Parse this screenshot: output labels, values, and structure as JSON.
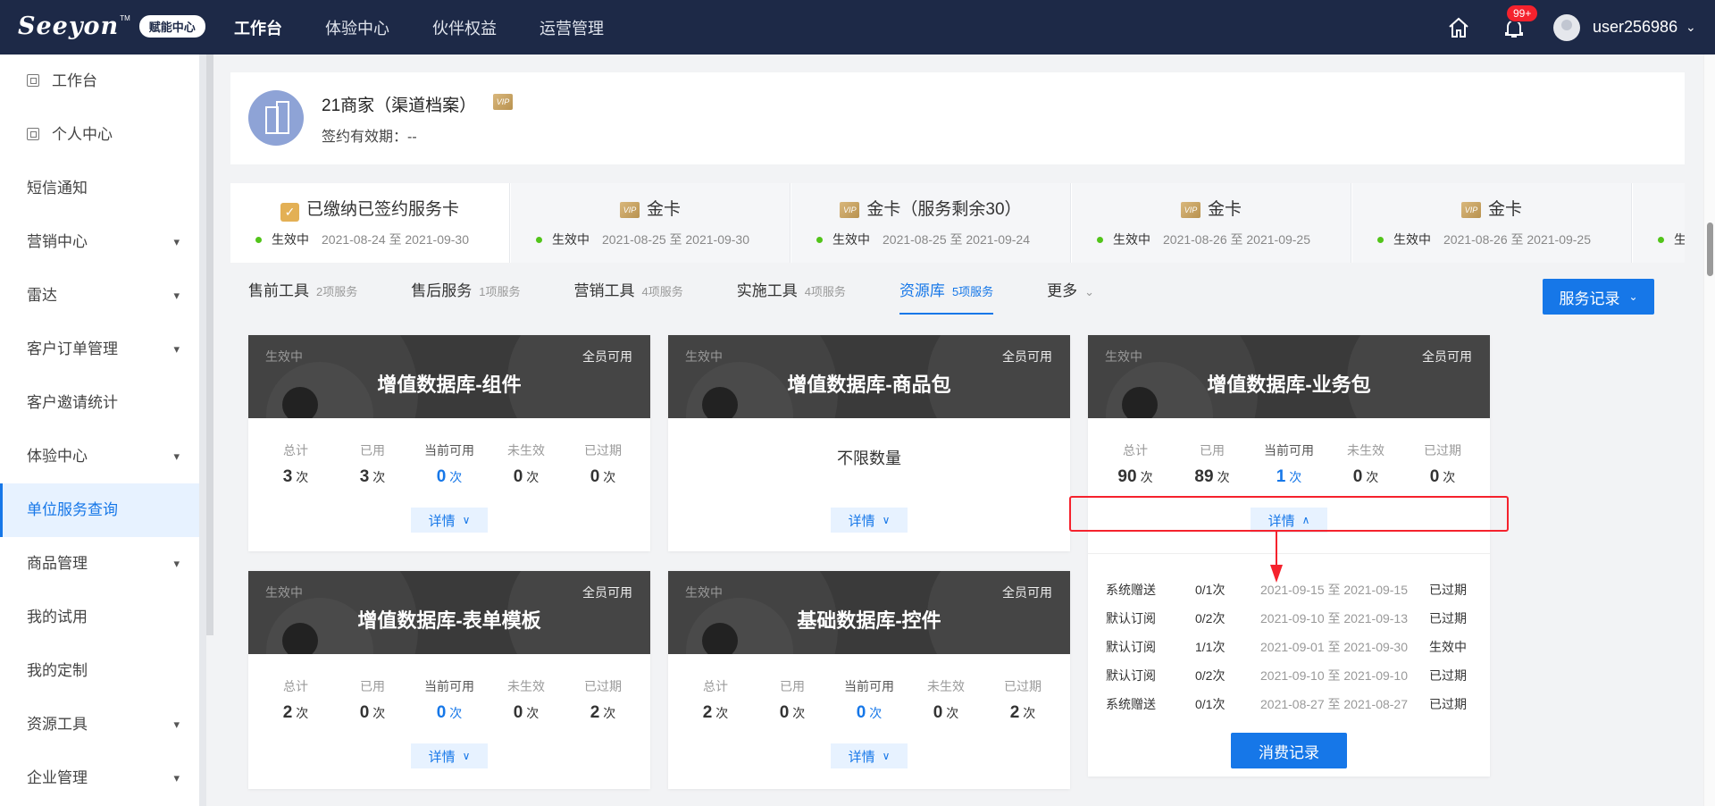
{
  "header": {
    "logo_text": "Seeyon",
    "logo_tm": "TM",
    "logo_badge": "赋能中心",
    "nav": [
      "工作台",
      "体验中心",
      "伙伴权益",
      "运营管理"
    ],
    "notification_count": "99+",
    "username": "user256986",
    "colors": {
      "bg": "#1d2947",
      "badge": "#f5222d"
    }
  },
  "sidebar": {
    "items": [
      {
        "label": "工作台",
        "icon": "doc-icon"
      },
      {
        "label": "个人中心",
        "icon": "doc-icon"
      },
      {
        "label": "短信通知"
      },
      {
        "label": "营销中心",
        "expand": true
      },
      {
        "label": "雷达",
        "expand": true
      },
      {
        "label": "客户订单管理",
        "expand": true
      },
      {
        "label": "客户邀请统计"
      },
      {
        "label": "体验中心",
        "expand": true
      },
      {
        "label": "单位服务查询",
        "active": true
      },
      {
        "label": "商品管理",
        "expand": true
      },
      {
        "label": "我的试用"
      },
      {
        "label": "我的定制"
      },
      {
        "label": "资源工具",
        "expand": true
      },
      {
        "label": "企业管理",
        "expand": true
      }
    ]
  },
  "profile": {
    "name": "21商家（渠道档案）",
    "vip": "VIP",
    "valid_label": "签约有效期：",
    "valid_value": "--"
  },
  "service_cards": [
    {
      "title": "已缴纳已签约服务卡",
      "status": "生效中",
      "date": "2021-08-24 至 2021-09-30",
      "icon": "check-icon",
      "active": true
    },
    {
      "title": "金卡",
      "status": "生效中",
      "date": "2021-08-25 至 2021-09-30",
      "icon": "vip-icon"
    },
    {
      "title": "金卡（服务剩余30）",
      "status": "生效中",
      "date": "2021-08-25 至 2021-09-24",
      "icon": "vip-icon"
    },
    {
      "title": "金卡",
      "status": "生效中",
      "date": "2021-08-26 至 2021-09-25",
      "icon": "vip-icon"
    },
    {
      "title": "金卡",
      "status": "生效中",
      "date": "2021-08-26 至 2021-09-25",
      "icon": "vip-icon"
    },
    {
      "title": "",
      "status": "生效",
      "date": "",
      "icon": ""
    }
  ],
  "tabs": [
    {
      "label": "售前工具",
      "count": "2项服务"
    },
    {
      "label": "售后服务",
      "count": "1项服务"
    },
    {
      "label": "营销工具",
      "count": "4项服务"
    },
    {
      "label": "实施工具",
      "count": "4项服务"
    },
    {
      "label": "资源库",
      "count": "5项服务",
      "active": true
    },
    {
      "label": "更多",
      "count": ""
    }
  ],
  "service_record_button": "服务记录",
  "stat_labels": {
    "total": "总计",
    "used": "已用",
    "available": "当前可用",
    "pending": "未生效",
    "expired": "已过期"
  },
  "unit": "次",
  "status_active": "生效中",
  "scope_all": "全员可用",
  "detail_label": "详情",
  "unlimited_label": "不限数量",
  "resources": [
    {
      "title": "增值数据库-组件",
      "total": "3",
      "used": "3",
      "available": "0",
      "pending": "0",
      "expired": "0"
    },
    {
      "title": "增值数据库-商品包",
      "unlimited": true
    },
    {
      "title": "增值数据库-业务包",
      "total": "90",
      "used": "89",
      "available": "1",
      "pending": "0",
      "expired": "0",
      "expanded": true
    },
    {
      "title": "增值数据库-表单模板",
      "total": "2",
      "used": "0",
      "available": "0",
      "pending": "0",
      "expired": "2"
    },
    {
      "title": "基础数据库-控件",
      "total": "2",
      "used": "0",
      "available": "0",
      "pending": "0",
      "expired": "2"
    }
  ],
  "detail_rows": [
    {
      "source": "系统赠送",
      "count": "0/1次",
      "date": "2021-09-15 至 2021-09-15",
      "status": "已过期"
    },
    {
      "source": "默认订阅",
      "count": "0/2次",
      "date": "2021-09-10 至 2021-09-13",
      "status": "已过期"
    },
    {
      "source": "默认订阅",
      "count": "1/1次",
      "date": "2021-09-01 至 2021-09-30",
      "status": "生效中"
    },
    {
      "source": "默认订阅",
      "count": "0/2次",
      "date": "2021-09-10 至 2021-09-10",
      "status": "已过期"
    },
    {
      "source": "系统赠送",
      "count": "0/1次",
      "date": "2021-08-27 至 2021-08-27",
      "status": "已过期"
    }
  ],
  "consume_record_button": "消费记录"
}
